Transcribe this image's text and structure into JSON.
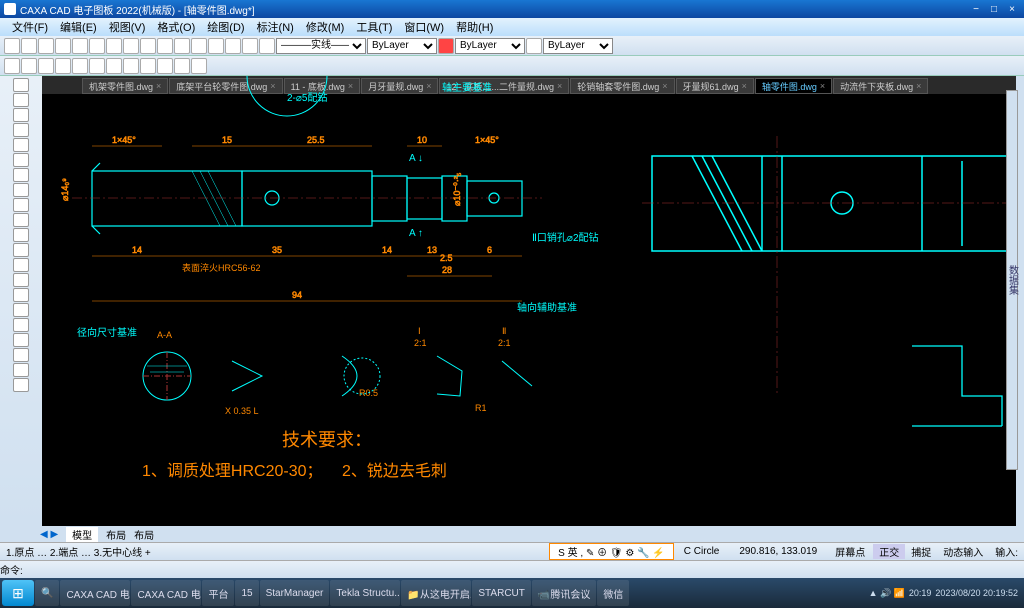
{
  "app": {
    "title": "CAXA CAD 电子图板 2022(机械版) - [轴零件图.dwg*]"
  },
  "menu": [
    "文件(F)",
    "编辑(E)",
    "视图(V)",
    "格式(O)",
    "绘图(D)",
    "标注(N)",
    "修改(M)",
    "工具(T)",
    "窗口(W)",
    "帮助(H)"
  ],
  "toolbar2": {
    "layer": "ByLayer",
    "line": "———实线———",
    "color": "ByLayer",
    "lw": "ByLayer"
  },
  "tabs": [
    "机架零件图.dwg",
    "底架平台轮零件图.dwg",
    "11 - 底板.dwg",
    "月牙量规.dwg",
    "12 - 底板二...二件量规.dwg",
    "轮销轴套零件图.dwg",
    "牙量规61.dwg",
    "轴零件图.dwg",
    "动流件下夹板.dwg"
  ],
  "active_tab": 7,
  "bottom_tabs": [
    "模型",
    "布局",
    "布局"
  ],
  "drawing": {
    "dims": {
      "d1": "1×45°",
      "d2": "15",
      "d3": "25.5",
      "d4": "10",
      "d5": "14",
      "d6": "35",
      "d7": "14",
      "d8": "13",
      "d9": "6",
      "d10": "94",
      "d11": "28",
      "d12": "2.5",
      "dia": "⌀14₀⁹",
      "w3": "⌀10⁻⁰·²₅",
      "cham": "1×45°"
    },
    "labels": {
      "a": "A",
      "al": "A ↓",
      "ar": "A ↑",
      "sec": "A-A",
      "i": "Ⅰ",
      "i2": "Ⅱ",
      "scale": "2:1",
      "jinxiang": "径向尺寸基准",
      "zhouzhu": "轴主要基准",
      "zhouxiang": "轴向辅助基准",
      "hole": "Ⅱ口销孔⌀2配钻",
      "surface": "表面淬火HRC56-62",
      "chamfer": "2-⌀5配钻",
      "r": "R0.5",
      "r1": "R1",
      "xs": "X 0.35 L"
    },
    "notes": {
      "title": "技术要求：",
      "n1": "1、调质处理HRC20-30；",
      "n2": "2、锐边去毛刺"
    }
  },
  "status": {
    "modes": "1.原点 … 2.端点 … 3.无中心线 +",
    "coords": "290.816, 133.019",
    "cmd": "C Circle",
    "ime": "S 英 , ✎ ⊕ 🛡 ⚙ 🔧 ⚡",
    "ortho": "正交",
    "snap": "捕捉",
    "dyn": "动态输入",
    "zoom": "屏幕点",
    "input": "输入:"
  },
  "cmdline": "命令:",
  "taskbar": [
    "CAXA CAD 电...",
    "CAXA CAD 电...",
    "平台",
    "15",
    "StarManager",
    "Tekla Structu...",
    "📁从这电开启...",
    "STARCUT",
    "📹腾讯会议",
    "微信"
  ],
  "clock": {
    "time": "20:19",
    "date": "2023/08/20 20:19:52"
  },
  "panel_r": "数据集"
}
